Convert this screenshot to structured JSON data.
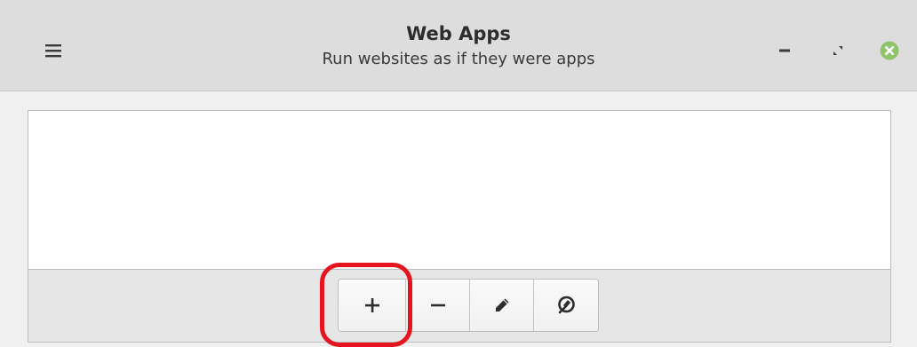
{
  "header": {
    "title": "Web Apps",
    "subtitle": "Run websites as if they were apps"
  },
  "icons": {
    "menu": "hamburger-menu-icon",
    "minimize": "minimize-icon",
    "maximize": "maximize-icon",
    "close": "close-icon",
    "add": "plus-icon",
    "remove": "minus-icon",
    "edit": "pencil-icon",
    "launch": "rocket-launch-icon"
  },
  "colors": {
    "close_button": "#8fc46a",
    "highlight": "#e5141e"
  }
}
